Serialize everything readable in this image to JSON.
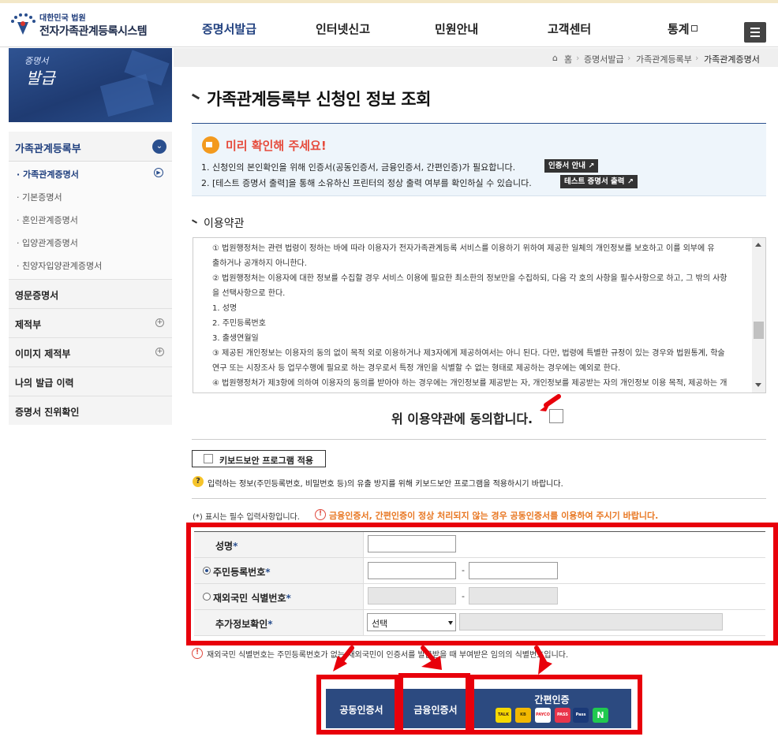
{
  "header": {
    "logo_top": "대한민국 법원",
    "logo_main": "전자가족관계등록시스템",
    "nav": [
      "증명서발급",
      "인터넷신고",
      "민원안내",
      "고객센터",
      "통계"
    ]
  },
  "breadcrumb": [
    "홈",
    "증명서발급",
    "가족관계등록부",
    "가족관계증명서"
  ],
  "banner": {
    "t1": "증명서",
    "t2": "발급"
  },
  "sidebar": {
    "head": "가족관계등록부",
    "subs": [
      "가족관계증명서",
      "기본증명서",
      "혼인관계증명서",
      "입양관계증명서",
      "친양자입양관계증명서"
    ],
    "items": [
      "영문증명서",
      "제적부",
      "이미지 제적부",
      "나의 발급 이력",
      "증명서 진위확인"
    ]
  },
  "page_title": "가족관계등록부 신청인 정보 조회",
  "notice": {
    "title": "미리 확인해 주세요!",
    "line1": "1. 신청인의 본인확인을 위해 인증서(공동인증서, 금융인증서, 간편인증)가 필요합니다.",
    "btn1": "인증서 안내",
    "line2": "2. [테스트 증명서 출력]을 통해 소유하신 프린터의 정상 출력 여부를 확인하실 수 있습니다.",
    "btn2": "테스트 증명서 출력"
  },
  "terms": {
    "title": "이용약관",
    "lines": [
      "① 법원행정처는 관련 법령이 정하는 바에 따라 이용자가 전자가족관계등록 서비스를 이용하기 위하여 제공한 일체의 개인정보를 보호하고 이를 외부에 유",
      "출하거나 공개하지 아니한다.",
      "② 법원행정처는 이용자에 대한 정보를 수집할 경우 서비스 이용에 필요한 최소한의 정보만을 수집하되, 다음 각 호의 사항을 필수사항으로 하고, 그 밖의 사항",
      "을 선택사항으로 한다.",
      "1. 성명",
      "2. 주민등록번호",
      "3. 출생연월일",
      "③ 제공된 개인정보는 이용자의 동의 없이 목적 외로 이용하거나 제3자에게 제공하여서는 아니 된다. 다만, 법령에 특별한 규정이 있는 경우와 법원통계, 학술",
      "연구 또는 시장조사 등 업무수행에 필요로 하는 경우로서 특정 개인을 식별할 수 없는 형태로 제공하는 경우에는 예외로 한다.",
      "④ 법원행정처가 제3항에 의하여 이용자의 동의를 받아야 하는 경우에는 개인정보를 제공받는 자, 개인정보를 제공받는 자의 개인정보 이용 목적, 제공하는 개"
    ],
    "agree": "위 이용약관에 동의합니다."
  },
  "keyboard": {
    "button": "키보드보안 프로그램 적용",
    "note": "입력하는 정보(주민등록번호, 비밀번호 등)의 유출 방지를 위해 키보드보안 프로그램을 적용하시기 바랍니다."
  },
  "form": {
    "required_note": "(*) 표시는 필수 입력사항입니다.",
    "warning": "금융인증서, 간편인증이 정상 처리되지 않는 경우 공동인증서를 이용하여 주시기 바랍니다.",
    "name_label": "성명",
    "rrn_label": "주민등록번호",
    "foreign_label": "재외국민 식별번호",
    "extra_label": "추가정보확인",
    "star": "*",
    "select_value": "선택",
    "dash": "-",
    "foot_note": "재외국민 식별번호는 주민등록번호가 없는 재외국민이 인증서를 발급받을 때 부여받은 임의의 식별번호입니다."
  },
  "buttons": {
    "joint": "공동인증서",
    "financial": "금융인증서",
    "simple": "간편인증",
    "apps": [
      "TALK",
      "KB",
      "PAYCO",
      "PASS",
      "Pass",
      "N"
    ]
  },
  "colors": {
    "primary": "#2c4a80",
    "highlight": "#e8000b",
    "warning": "#e87722",
    "notice_title": "#e64b3c"
  }
}
